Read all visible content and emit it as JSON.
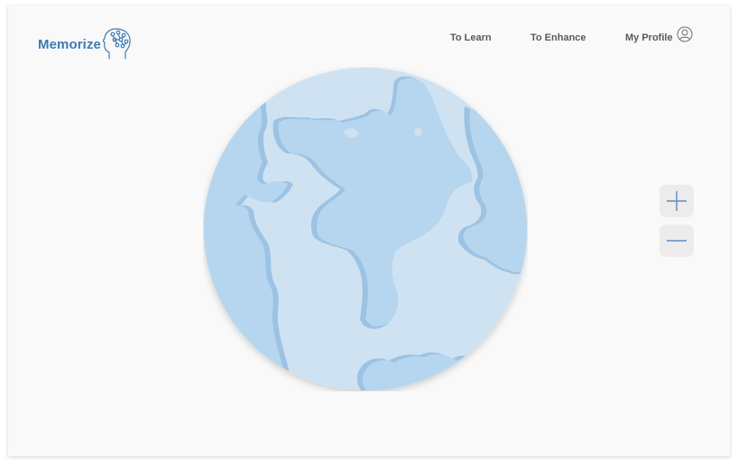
{
  "app": {
    "name": "Memorize"
  },
  "nav": {
    "to_learn": "To Learn",
    "to_enhance": "To Enhance",
    "my_profile": "My Profile"
  },
  "icons": {
    "logo": "brain-head-icon",
    "profile": "user-avatar-icon",
    "zoom_in": "plus-icon",
    "zoom_out": "minus-icon"
  },
  "colors": {
    "brand": "#3d7ab5",
    "ocean": "#cfe2f1",
    "land": "#b5d6ee",
    "land_shadow": "#9cc2e4",
    "nav_text": "#555a60",
    "zoom_button_bg": "#ececec"
  }
}
